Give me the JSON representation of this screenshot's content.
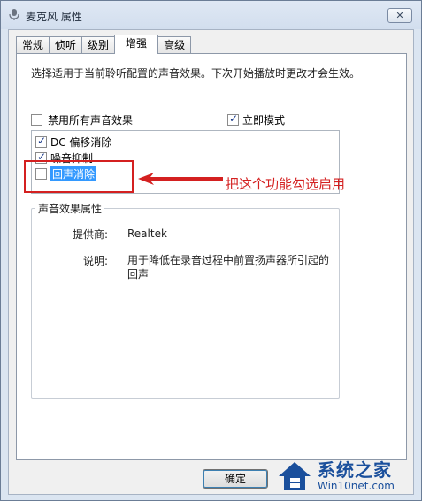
{
  "window": {
    "title": "麦克风 属性",
    "close_label": "✕"
  },
  "tabs": [
    {
      "label": "常规",
      "active": false
    },
    {
      "label": "侦听",
      "active": false
    },
    {
      "label": "级别",
      "active": false
    },
    {
      "label": "增强",
      "active": true
    },
    {
      "label": "高级",
      "active": false
    }
  ],
  "enhancements": {
    "description": "选择适用于当前聆听配置的声音效果。下次开始播放时更改才会生效。",
    "disable_all": {
      "label": "禁用所有声音效果",
      "checked": false
    },
    "immediate_mode": {
      "label": "立即模式",
      "checked": true
    },
    "effects": [
      {
        "label": "DC 偏移消除",
        "checked": true,
        "selected": false
      },
      {
        "label": "噪音抑制",
        "checked": true,
        "selected": false
      },
      {
        "label": "回声消除",
        "checked": false,
        "selected": true
      }
    ],
    "annotation": "把这个功能勾选启用",
    "properties": {
      "title": "声音效果属性",
      "provider_label": "提供商:",
      "provider_value": "Realtek",
      "description_label": "说明:",
      "description_value": "用于降低在录音过程中前置扬声器所引起的回声"
    }
  },
  "footer": {
    "ok_label": "确定"
  },
  "watermark": {
    "main": "系统之家",
    "sub": "Win10net.com"
  },
  "colors": {
    "annotation": "#d42020",
    "selection": "#3399ff",
    "watermark": "#1a4f9c"
  }
}
